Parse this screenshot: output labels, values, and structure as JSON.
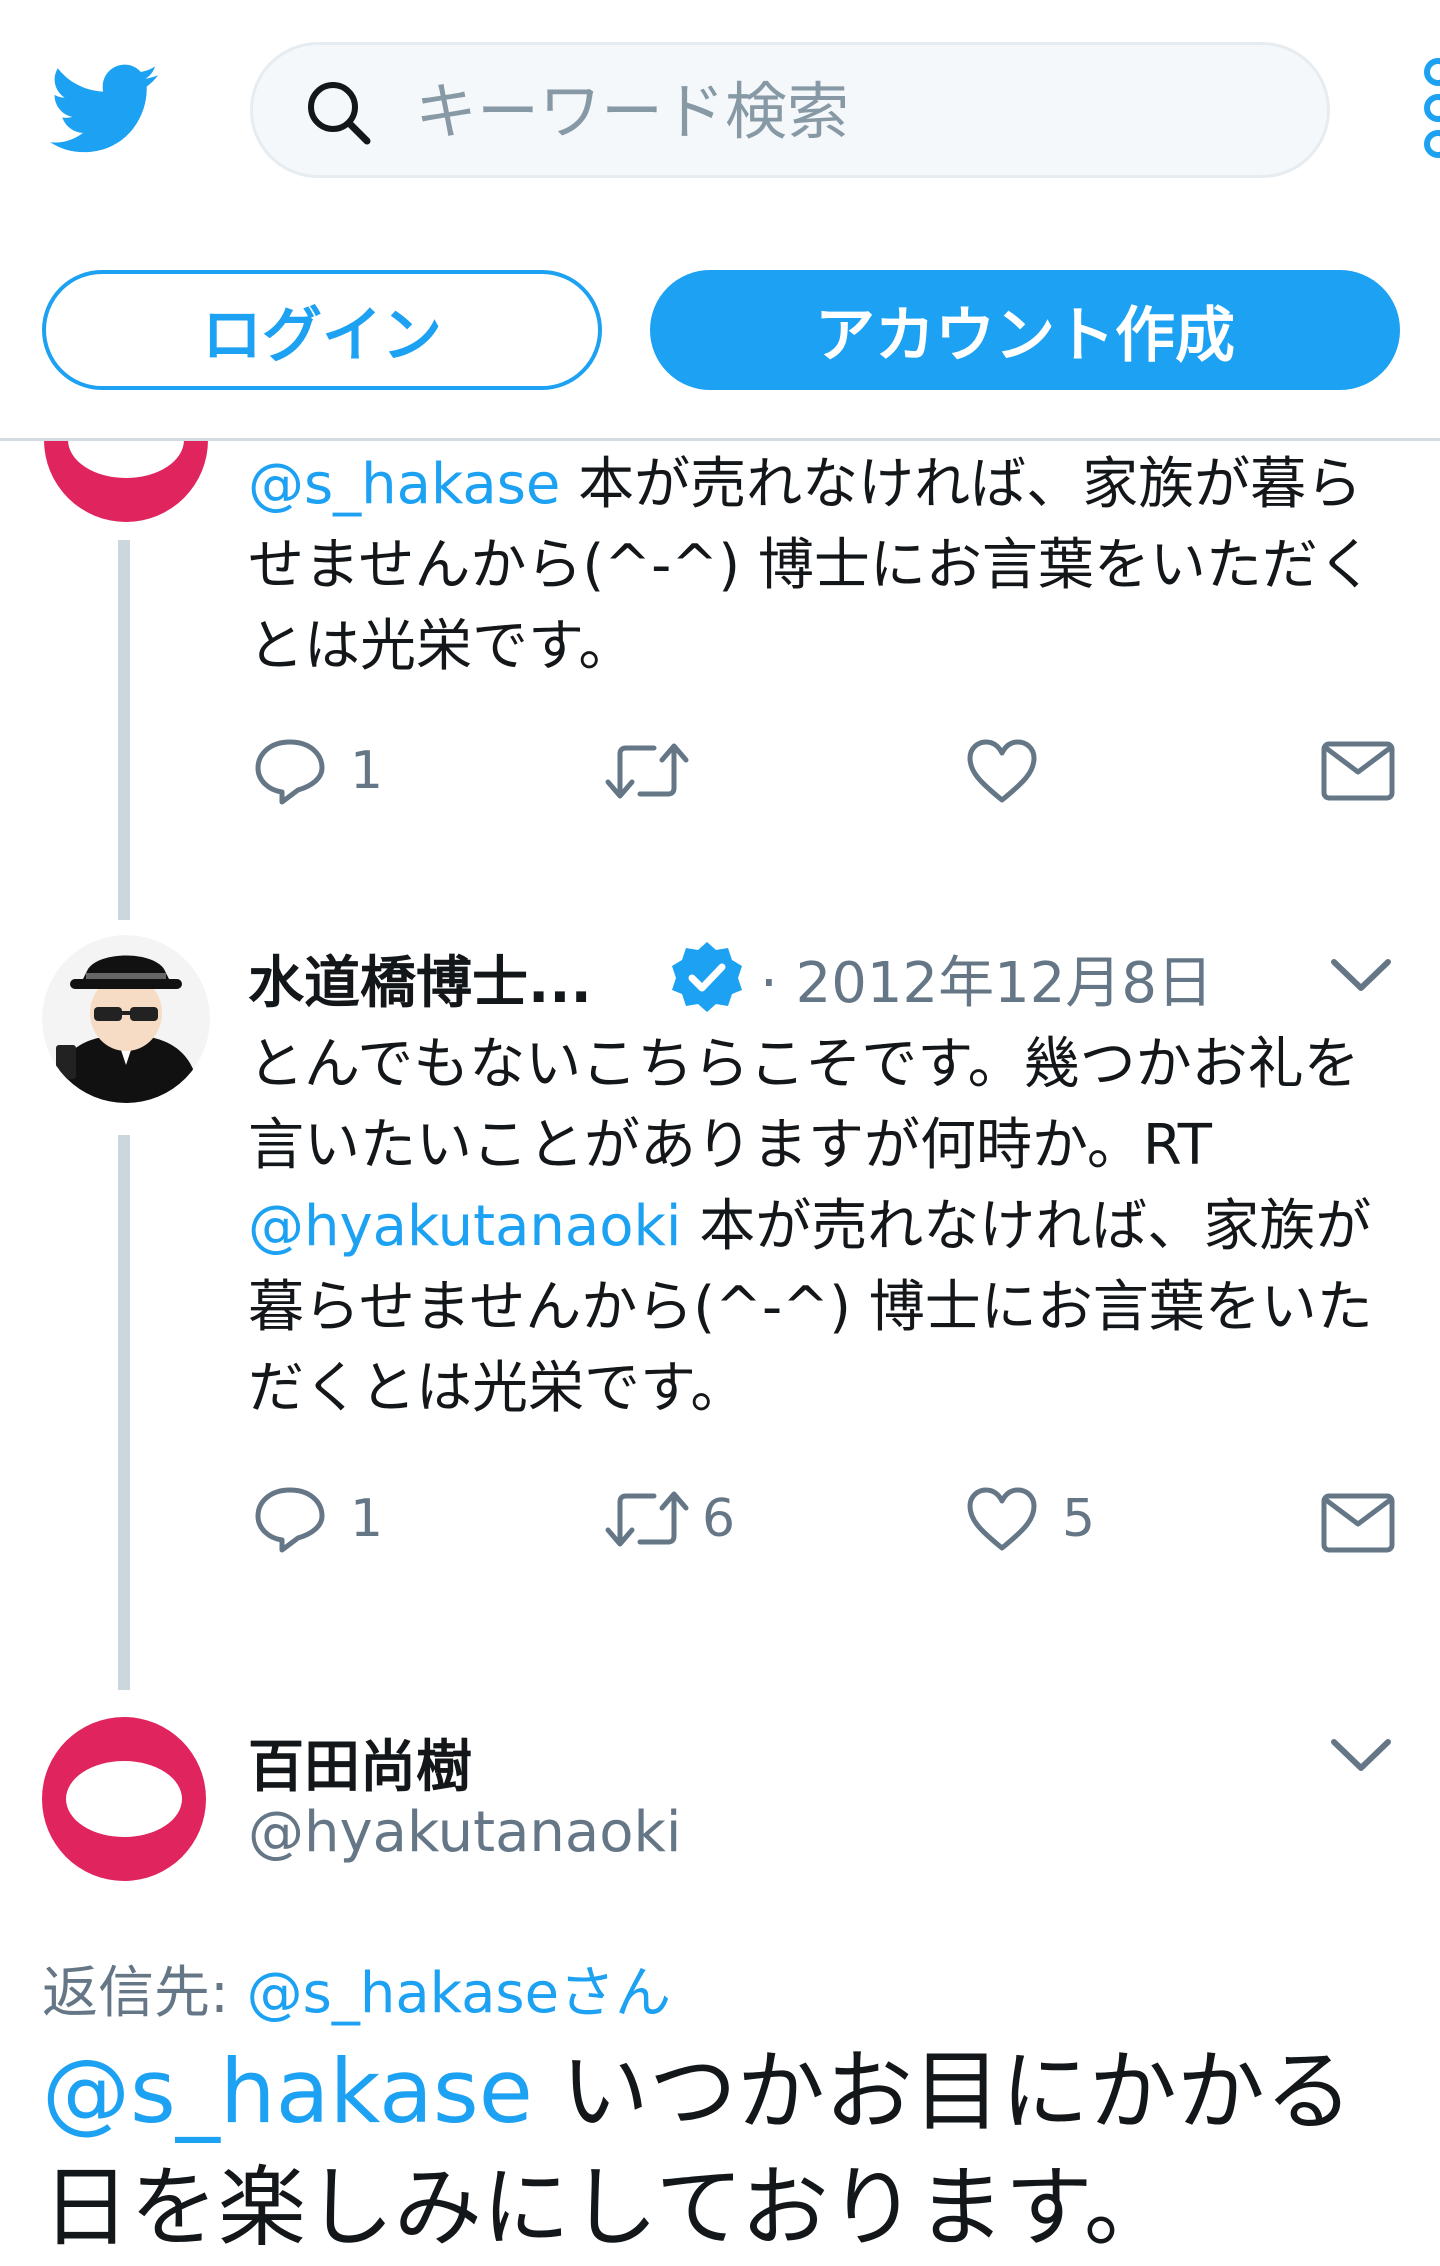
{
  "header": {
    "search_placeholder": "キーワード検索",
    "login_label": "ログイン",
    "signup_label": "アカウント作成"
  },
  "tweet1": {
    "mention": "@s_hakase",
    "text": " 本が売れなければ、家族が暮らせませんから(^-^) 博士にお言葉をいただくとは光栄です。",
    "reply_count": "1"
  },
  "tweet2": {
    "display_name": "水道橋博士...",
    "date": "· 2012年12月8日",
    "text_before": "とんでもないこちらこそです。幾つかお礼を言いたいことがありますが何時か。RT ",
    "mention": "@hyakutanaoki",
    "text_after": " 本が売れなければ、家族が暮らせませんから(^-^) 博士にお言葉をいただくとは光栄です。",
    "reply_count": "1",
    "retweet_count": "6",
    "like_count": "5"
  },
  "tweet3": {
    "display_name": "百田尚樹",
    "handle": "@hyakutanaoki",
    "reply_to_label": "返信先: ",
    "reply_to_user": "@s_hakaseさん",
    "mention": "@s_hakase",
    "text": " いつかお目にかかる日を楽しみにしております。"
  },
  "colors": {
    "accent": "#1da1f2",
    "avatar_pink": "#e0245e",
    "verified": "#1da1f2",
    "muted": "#657786"
  }
}
